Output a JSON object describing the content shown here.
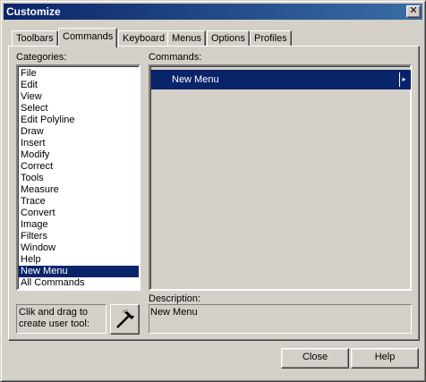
{
  "window": {
    "title": "Customize",
    "close_glyph": "✕"
  },
  "tabs": [
    {
      "label": "Toolbars"
    },
    {
      "label": "Commands",
      "active": true
    },
    {
      "label": "Keyboard"
    },
    {
      "label": "Menus"
    },
    {
      "label": "Options"
    },
    {
      "label": "Profiles"
    }
  ],
  "categories": {
    "label": "Categories:",
    "items": [
      "File",
      "Edit",
      "View",
      "Select",
      "Edit Polyline",
      "Draw",
      "Insert",
      "Modify",
      "Correct",
      "Tools",
      "Measure",
      "Trace",
      "Convert",
      "Image",
      "Filters",
      "Window",
      "Help",
      "New Menu",
      "All Commands"
    ],
    "selected": "New Menu"
  },
  "commands": {
    "label": "Commands:",
    "items": [
      "New Menu"
    ],
    "submenu_glyph": "▸"
  },
  "description": {
    "label": "Description:",
    "text": "New Menu"
  },
  "drag": {
    "text": "Clik and drag to create user tool:",
    "icon": "hammer-icon"
  },
  "buttons": {
    "close": "Close",
    "help": "Help"
  },
  "colors": {
    "selection": "#0a246a",
    "face": "#d4d0c8",
    "title_start": "#0a246a",
    "title_end": "#3a6ea5"
  }
}
